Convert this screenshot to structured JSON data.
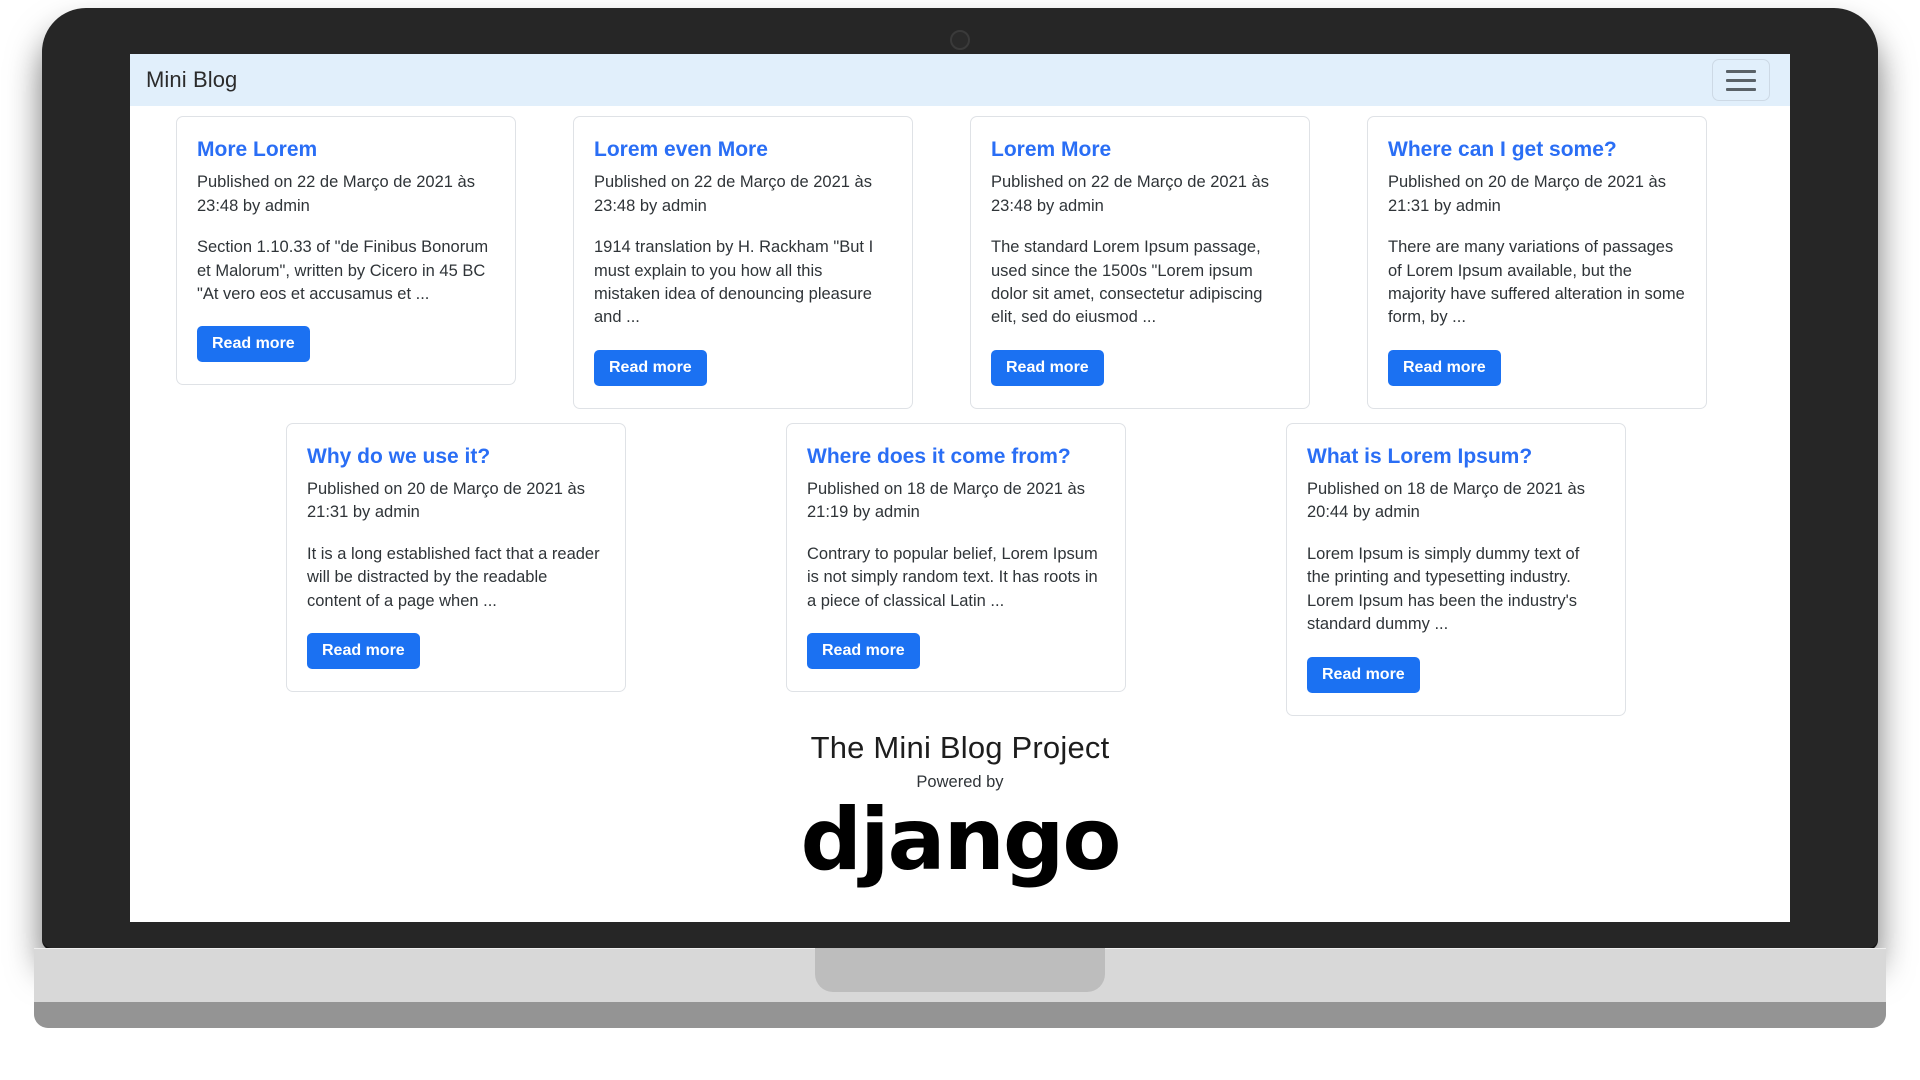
{
  "navbar": {
    "brand": "Mini Blog",
    "toggler_label": "menu"
  },
  "colors": {
    "navbar_bg": "#e1effb",
    "link_blue": "#2a6ef5",
    "button_blue": "#1b71f2",
    "card_border": "#dfe2e6",
    "text": "#2f3438"
  },
  "posts_row_1": [
    {
      "title": "More Lorem",
      "meta": "Published on 22 de Março de 2021 às 23:48 by admin",
      "excerpt": "Section 1.10.33 of \"de Finibus Bonorum et Malorum\", written by Cicero in 45 BC \"At vero eos et accusamus et ...",
      "button": "Read more"
    },
    {
      "title": "Lorem even More",
      "meta": "Published on 22 de Março de 2021 às 23:48 by admin",
      "excerpt": "1914 translation by H. Rackham \"But I must explain to you how all this mistaken idea of denouncing pleasure and ...",
      "button": "Read more"
    },
    {
      "title": "Lorem More",
      "meta": "Published on 22 de Março de 2021 às 23:48 by admin",
      "excerpt": "The standard Lorem Ipsum passage, used since the 1500s \"Lorem ipsum dolor sit amet, consectetur adipiscing elit, sed do eiusmod ...",
      "button": "Read more"
    },
    {
      "title": "Where can I get some?",
      "meta": "Published on 20 de Março de 2021 às 21:31 by admin",
      "excerpt": "There are many variations of passages of Lorem Ipsum available, but the majority have suffered alteration in some form, by ...",
      "button": "Read more"
    }
  ],
  "posts_row_2": [
    {
      "title": "Why do we use it?",
      "meta": "Published on 20 de Março de 2021 às 21:31 by admin",
      "excerpt": "It is a long established fact that a reader will be distracted by the readable content of a page when ...",
      "button": "Read more"
    },
    {
      "title": "Where does it come from?",
      "meta": "Published on 18 de Março de 2021 às 21:19 by admin",
      "excerpt": "Contrary to popular belief, Lorem Ipsum is not simply random text. It has roots in a piece of classical Latin ...",
      "button": "Read more"
    },
    {
      "title": "What is Lorem Ipsum?",
      "meta": "Published on 18 de Março de 2021 às 20:44 by admin",
      "excerpt": "Lorem Ipsum is simply dummy text of the printing and typesetting industry. Lorem Ipsum has been the industry's standard dummy ...",
      "button": "Read more"
    }
  ],
  "footer": {
    "title": "The Mini Blog Project",
    "powered_by": "Powered by",
    "logo_text": "django"
  }
}
